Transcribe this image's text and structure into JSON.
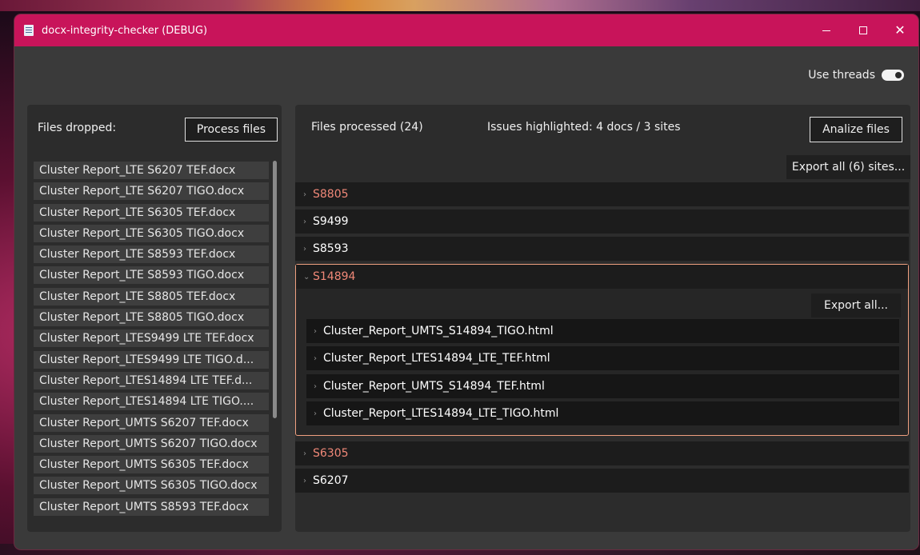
{
  "window": {
    "title": "docx-integrity-checker (DEBUG)",
    "controls": {
      "minimize": "—",
      "maximize": "☐",
      "close": "✕"
    }
  },
  "topbar": {
    "threads_label": "Use threads",
    "threads_on": true
  },
  "left": {
    "header_label": "Files dropped:",
    "process_label": "Process files",
    "files": [
      "Cluster Report_LTE S6207 TEF.docx",
      "Cluster Report_LTE S6207 TIGO.docx",
      "Cluster Report_LTE S6305 TEF.docx",
      "Cluster Report_LTE S6305 TIGO.docx",
      "Cluster Report_LTE S8593 TEF.docx",
      "Cluster Report_LTE S8593 TIGO.docx",
      "Cluster Report_LTE S8805 TEF.docx",
      "Cluster Report_LTE S8805 TIGO.docx",
      "Cluster Report_LTES9499 LTE TEF.docx",
      "Cluster Report_LTES9499 LTE TIGO.d...",
      "Cluster Report_LTES14894 LTE TEF.d...",
      "Cluster Report_LTES14894 LTE TIGO....",
      "Cluster Report_UMTS S6207 TEF.docx",
      "Cluster Report_UMTS S6207 TIGO.docx",
      "Cluster Report_UMTS S6305 TEF.docx",
      "Cluster Report_UMTS S6305 TIGO.docx",
      "Cluster Report_UMTS S8593 TEF.docx"
    ]
  },
  "right": {
    "processed_label": "Files processed (24)",
    "issues_label": "Issues highlighted: 4 docs / 3 sites",
    "analize_label": "Analize files",
    "export_sites_label": "Export all (6) sites...",
    "sites": [
      {
        "name": "S8805",
        "issue": true
      },
      {
        "name": "S9499",
        "issue": false
      },
      {
        "name": "S8593",
        "issue": false
      },
      {
        "name": "S14894",
        "issue": true,
        "expanded": true
      },
      {
        "name": "S6305",
        "issue": true
      },
      {
        "name": "S6207",
        "issue": false
      }
    ],
    "expanded": {
      "export_label": "Export all...",
      "docs": [
        {
          "name": "Cluster_Report_UMTS_S14894_TIGO.html",
          "issue": false
        },
        {
          "name": "Cluster_Report_LTES14894_LTE_TEF.html",
          "issue": true
        },
        {
          "name": "Cluster_Report_UMTS_S14894_TEF.html",
          "issue": false
        },
        {
          "name": "Cluster_Report_LTES14894_LTE_TIGO.html",
          "issue": true
        }
      ]
    }
  },
  "colors": {
    "titlebar": "#c8145a",
    "issue_text": "#f08878",
    "expanded_border": "#f0a080"
  }
}
